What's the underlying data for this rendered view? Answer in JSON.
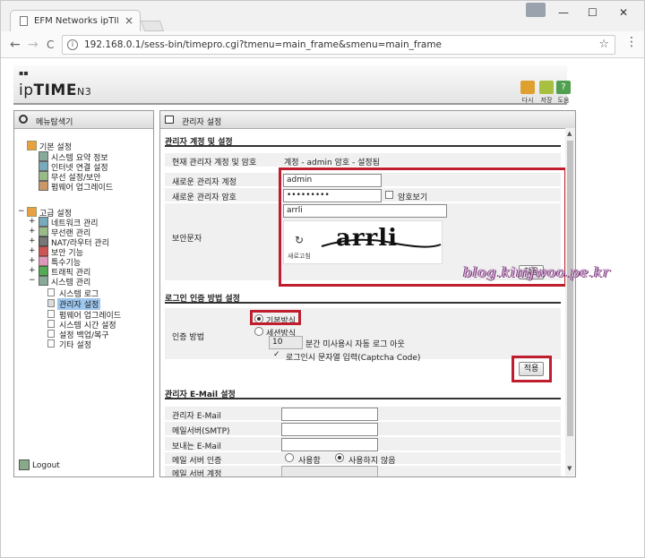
{
  "browser": {
    "tab_title": "EFM Networks ipTIME N",
    "tab_close": "×",
    "url": "192.168.0.1/sess-bin/timepro.cgi?tmenu=main_frame&smenu=main_frame",
    "window_controls": [
      "—",
      "☐",
      "✕"
    ],
    "nav": {
      "back": "←",
      "forward": "→",
      "reload": "C"
    },
    "star": "☆",
    "menu": "⋮"
  },
  "header": {
    "logo_prefix": "ip",
    "logo_bold": "TIME",
    "logo_model": "N3",
    "buttons": [
      {
        "label": "다시",
        "icon": "refresh-icon",
        "color": "#e0a030"
      },
      {
        "label": "저장",
        "icon": "save-icon",
        "color": "#a8c040"
      },
      {
        "label": "도움",
        "icon": "help-icon",
        "color": "#50a050"
      }
    ]
  },
  "sidebar": {
    "title": "메뉴탐색기",
    "basic_group": "기본 설정",
    "basic_items": [
      "시스템 요약 정보",
      "인터넷 연결 설정",
      "무선 설정/보안",
      "펌웨어 업그레이드"
    ],
    "advanced_group": "고급 설정",
    "advanced_items": [
      "네트워크 관리",
      "무선랜 관리",
      "NAT/라우터 관리",
      "보안 기능",
      "특수기능",
      "트래픽 관리",
      "시스템 관리"
    ],
    "system_items": [
      "시스템 로그",
      "관리자 설정",
      "펌웨어 업그레이드",
      "시스템 시간 설정",
      "설정 백업/복구",
      "기타 설정"
    ],
    "selected": "관리자 설정",
    "logout": "Logout"
  },
  "main": {
    "title": "관리자 설정",
    "account_section": {
      "title": "관리자 계정 및 설정",
      "current_label": "현재 관리자 계정 및 암호",
      "current_value": "계정 - admin    암호 - 설정됨",
      "new_account_label": "새로운 관리자 계정",
      "new_account_value": "admin",
      "new_password_label": "새로운 관리자 암호",
      "new_password_value": "•••••••••",
      "show_password_label": "암호보기",
      "captcha_label": "보안문자",
      "captcha_input": "arrli",
      "captcha_text": "arrli",
      "refresh_label": "새로고침",
      "apply": "적용"
    },
    "login_section": {
      "title": "로그인 인증 방법 설정",
      "method_label": "인증 방법",
      "basic_option": "기본방식",
      "session_option": "세션방식",
      "timeout_value": "10",
      "timeout_text": "분간 미사용시 자동 로그 아웃",
      "captcha_option": "로그인시 문자열 입력(Captcha Code)",
      "apply": "적용"
    },
    "email_section": {
      "title": "관리자 E-Mail 설정",
      "admin_email_label": "관리자 E-Mail",
      "smtp_label": "메일서버(SMTP)",
      "sender_label": "보내는 E-Mail",
      "auth_label": "메일 서버 인증",
      "auth_use": "사용함",
      "auth_nouse": "사용하지 않음",
      "account_label": "메일 서버 계정"
    }
  },
  "watermark": "blog.kimjwoo.pe.kr",
  "colors": {
    "highlight": "#c01e2e",
    "selected_menu": "#9ec7ef"
  }
}
